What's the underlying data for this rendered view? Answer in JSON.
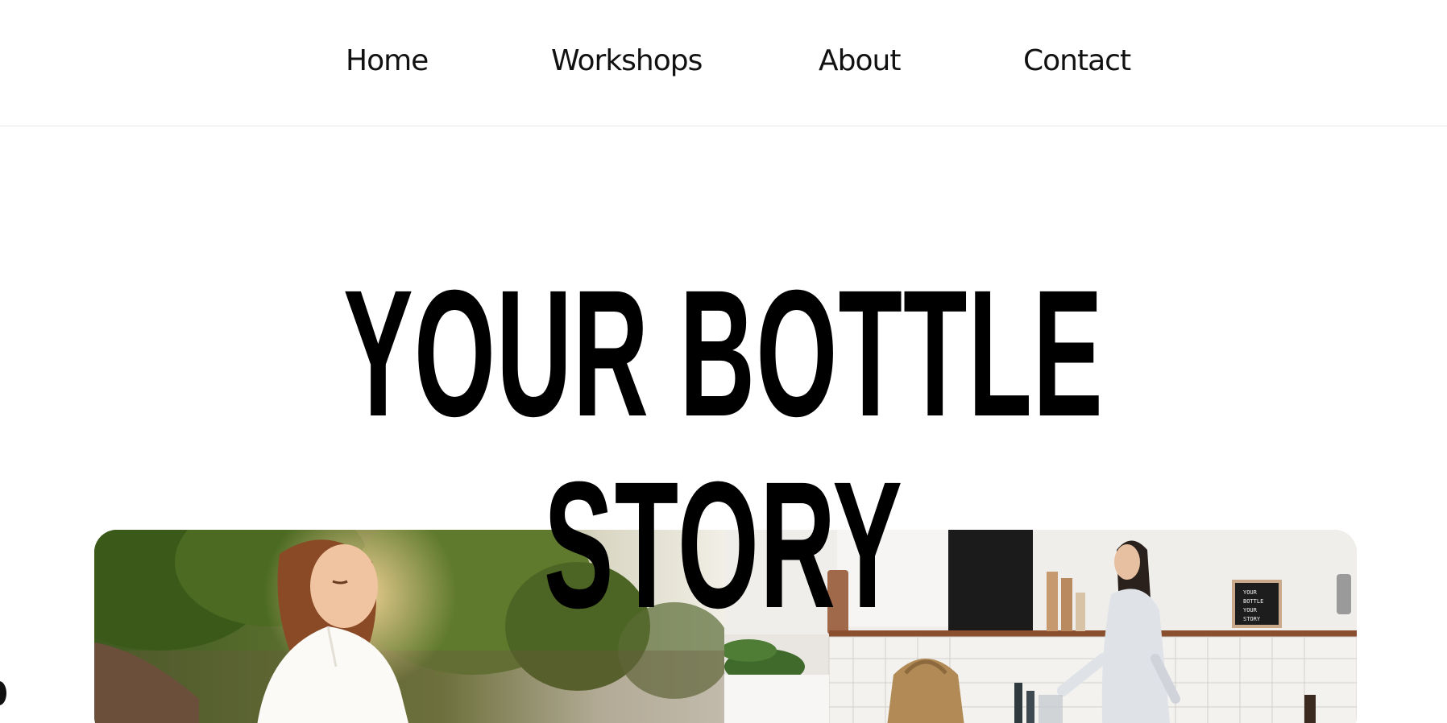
{
  "nav": {
    "items": [
      {
        "label": "Home"
      },
      {
        "label": "Workshops"
      },
      {
        "label": "About"
      },
      {
        "label": "Contact"
      }
    ]
  },
  "hero": {
    "title_line1": "YOUR BOTTLE",
    "title_line2": "STORY"
  },
  "photos": {
    "right_sign_lines": [
      "YOUR",
      "BOTTLE",
      "YOUR",
      "STORY"
    ]
  },
  "colors": {
    "text": "#000000",
    "background": "#ffffff",
    "divider": "#e6e6e6"
  }
}
